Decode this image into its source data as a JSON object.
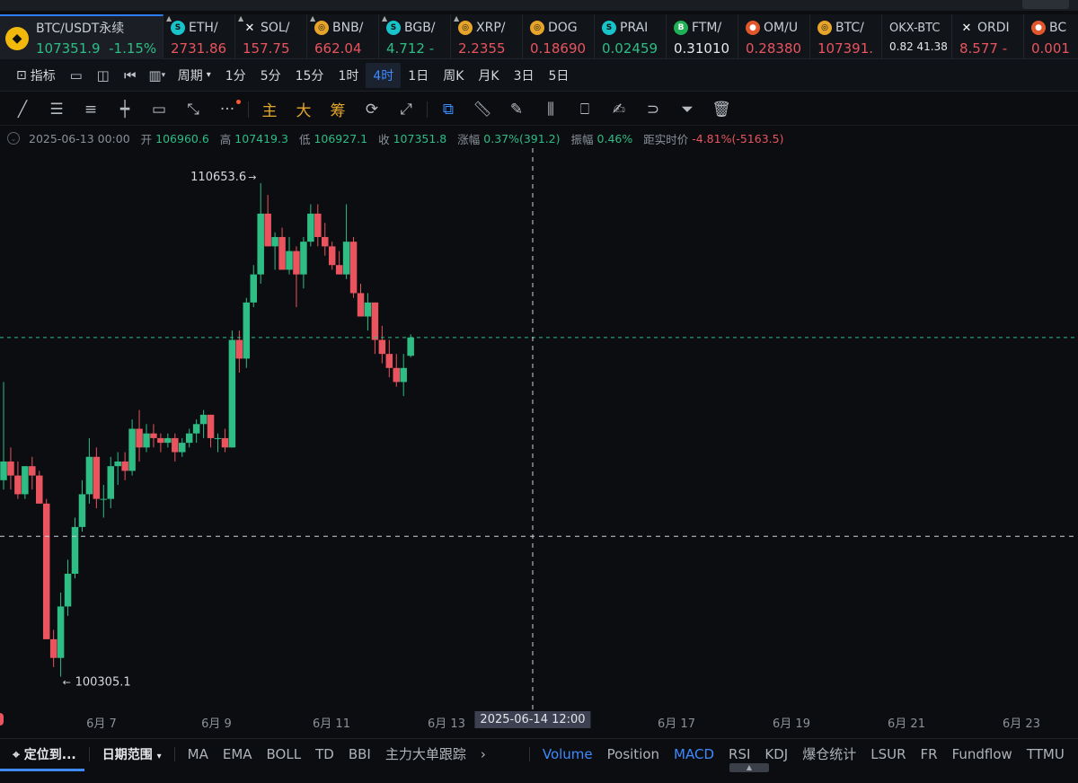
{
  "tickers": [
    {
      "symbol": "BTC/USDT永续",
      "price": "107351.9",
      "change": "-1.15%",
      "coin": "binance",
      "color": "#f0b90b",
      "active": true,
      "price_color": "green",
      "change_color": "green"
    },
    {
      "symbol": "ETH/",
      "price": "2731.86",
      "coin": "s-icon",
      "color": "#18c3c9",
      "price_color": "red"
    },
    {
      "symbol": "SOL/",
      "price": "157.75",
      "coin": "x-icon",
      "color": "#ffffff",
      "price_color": "red"
    },
    {
      "symbol": "BNB/",
      "price": "662.04",
      "coin": "gold",
      "color": "#e6a42b",
      "price_color": "red"
    },
    {
      "symbol": "BGB/",
      "price": "4.712 -",
      "coin": "s-icon",
      "color": "#18c3c9",
      "price_color": "green"
    },
    {
      "symbol": "XRP/",
      "price": "2.2355",
      "coin": "gold",
      "color": "#e6a42b",
      "price_color": "red"
    },
    {
      "symbol": "DOG",
      "price": "0.18690",
      "coin": "gold",
      "color": "#e6a42b",
      "price_color": "red"
    },
    {
      "symbol": "PRAI",
      "price": "0.02459",
      "coin": "s-icon",
      "color": "#18c3c9",
      "price_color": "green"
    },
    {
      "symbol": "FTM/",
      "price": "0.31010",
      "coin": "b-icon",
      "color": "#1fb157",
      "price_color": "white"
    },
    {
      "symbol": "OM/U",
      "price": "0.28380",
      "coin": "o-icon",
      "color": "#e0572b",
      "price_color": "red"
    },
    {
      "symbol": "BTC/",
      "price": "107391.",
      "coin": "gold",
      "color": "#e6a42b",
      "price_color": "red"
    },
    {
      "symbol": "OKX-BTC",
      "price": "0.82  41.38",
      "coin": "",
      "color": "",
      "price_color": "white"
    },
    {
      "symbol": "ORDI",
      "price": "8.577 -",
      "coin": "x-icon",
      "color": "#ffffff",
      "price_color": "red"
    },
    {
      "symbol": "BC",
      "price": "0.001",
      "coin": "o-icon",
      "color": "#e0572b",
      "price_color": "red"
    }
  ],
  "periodbar": {
    "indicators_label": "指标",
    "period_label": "周期",
    "periods": [
      "1分",
      "5分",
      "15分",
      "1时",
      "4时",
      "1日",
      "周K",
      "月K",
      "3日",
      "5日"
    ],
    "selected_period": "4时"
  },
  "drawbar": {
    "main_label": "主",
    "big_label": "大",
    "chip_label": "筹"
  },
  "info": {
    "datetime": "2025-06-13 00:00",
    "open_label": "开",
    "open": "106960.6",
    "high_label": "高",
    "high": "107419.3",
    "low_label": "低",
    "low": "106927.1",
    "close_label": "收",
    "close": "107351.8",
    "change_label": "涨幅",
    "change": "0.37%(391.2)",
    "amp_label": "振幅",
    "amp": "0.46%",
    "dist_label": "距实时价",
    "dist": "-4.81%(-5163.5)"
  },
  "chart_data": {
    "type": "candlestick",
    "interval": "4h",
    "price_range": [
      99400,
      111400
    ],
    "annotations": {
      "high_marker": "110653.6",
      "low_marker": "100305.1"
    },
    "colors": {
      "up": "#2ebd85",
      "down": "#e9545f",
      "crosshair": "#d0d4da",
      "price_line": "#2ebd85"
    },
    "crosshair_price": 107351.9,
    "crosshair_horizontal_price": 103100,
    "candles": [
      {
        "o": 104300,
        "h": 106400,
        "l": 104100,
        "c": 104700
      },
      {
        "o": 104700,
        "h": 105000,
        "l": 104100,
        "c": 104400
      },
      {
        "o": 104400,
        "h": 104700,
        "l": 103900,
        "c": 104000
      },
      {
        "o": 104000,
        "h": 104600,
        "l": 103900,
        "c": 104600
      },
      {
        "o": 104600,
        "h": 104800,
        "l": 104100,
        "c": 104400
      },
      {
        "o": 104400,
        "h": 104500,
        "l": 103800,
        "c": 103800
      },
      {
        "o": 103800,
        "h": 103900,
        "l": 100900,
        "c": 100900
      },
      {
        "o": 100900,
        "h": 101100,
        "l": 100305.1,
        "c": 100500
      },
      {
        "o": 100500,
        "h": 101900,
        "l": 100100,
        "c": 101600
      },
      {
        "o": 101600,
        "h": 102600,
        "l": 101400,
        "c": 102300
      },
      {
        "o": 102300,
        "h": 103500,
        "l": 102200,
        "c": 103300
      },
      {
        "o": 103300,
        "h": 104300,
        "l": 103200,
        "c": 104000
      },
      {
        "o": 104000,
        "h": 105200,
        "l": 103800,
        "c": 104800
      },
      {
        "o": 104800,
        "h": 105000,
        "l": 103700,
        "c": 103900
      },
      {
        "o": 103900,
        "h": 104200,
        "l": 103500,
        "c": 103900
      },
      {
        "o": 103900,
        "h": 104800,
        "l": 103700,
        "c": 104600
      },
      {
        "o": 104600,
        "h": 104900,
        "l": 104200,
        "c": 104700
      },
      {
        "o": 104700,
        "h": 104900,
        "l": 104300,
        "c": 104500
      },
      {
        "o": 104500,
        "h": 105600,
        "l": 104400,
        "c": 105400
      },
      {
        "o": 105400,
        "h": 105800,
        "l": 104700,
        "c": 105000
      },
      {
        "o": 105000,
        "h": 105500,
        "l": 104900,
        "c": 105300
      },
      {
        "o": 105300,
        "h": 105500,
        "l": 105000,
        "c": 105200
      },
      {
        "o": 105200,
        "h": 105300,
        "l": 104900,
        "c": 105100
      },
      {
        "o": 105100,
        "h": 105300,
        "l": 105000,
        "c": 105200
      },
      {
        "o": 105200,
        "h": 105300,
        "l": 104700,
        "c": 104900
      },
      {
        "o": 104900,
        "h": 105200,
        "l": 104800,
        "c": 105100
      },
      {
        "o": 105100,
        "h": 105400,
        "l": 105000,
        "c": 105300
      },
      {
        "o": 105300,
        "h": 105600,
        "l": 105100,
        "c": 105500
      },
      {
        "o": 105500,
        "h": 105800,
        "l": 105200,
        "c": 105700
      },
      {
        "o": 105700,
        "h": 105700,
        "l": 105000,
        "c": 105200
      },
      {
        "o": 105200,
        "h": 105300,
        "l": 104900,
        "c": 105200
      },
      {
        "o": 105200,
        "h": 105400,
        "l": 104900,
        "c": 105000
      },
      {
        "o": 105000,
        "h": 107500,
        "l": 105000,
        "c": 107300
      },
      {
        "o": 107300,
        "h": 107500,
        "l": 106600,
        "c": 106900
      },
      {
        "o": 106900,
        "h": 108200,
        "l": 106700,
        "c": 108100
      },
      {
        "o": 108100,
        "h": 108900,
        "l": 108000,
        "c": 108700
      },
      {
        "o": 108700,
        "h": 110653.6,
        "l": 108500,
        "c": 110000
      },
      {
        "o": 110000,
        "h": 110400,
        "l": 109300,
        "c": 109300
      },
      {
        "o": 109300,
        "h": 109600,
        "l": 108800,
        "c": 109500
      },
      {
        "o": 109500,
        "h": 109700,
        "l": 108800,
        "c": 108800
      },
      {
        "o": 108800,
        "h": 109500,
        "l": 108700,
        "c": 109200
      },
      {
        "o": 109200,
        "h": 109300,
        "l": 108000,
        "c": 108700
      },
      {
        "o": 108700,
        "h": 109500,
        "l": 108400,
        "c": 109400
      },
      {
        "o": 109400,
        "h": 110200,
        "l": 109300,
        "c": 110000
      },
      {
        "o": 110000,
        "h": 110200,
        "l": 109300,
        "c": 109500
      },
      {
        "o": 109500,
        "h": 109800,
        "l": 109100,
        "c": 109300
      },
      {
        "o": 109300,
        "h": 109400,
        "l": 108800,
        "c": 108900
      },
      {
        "o": 108900,
        "h": 109200,
        "l": 108700,
        "c": 108700
      },
      {
        "o": 108700,
        "h": 110200,
        "l": 108600,
        "c": 109400
      },
      {
        "o": 109400,
        "h": 109500,
        "l": 108200,
        "c": 108300
      },
      {
        "o": 108300,
        "h": 108500,
        "l": 107800,
        "c": 107800
      },
      {
        "o": 107800,
        "h": 108300,
        "l": 107500,
        "c": 108100
      },
      {
        "o": 108100,
        "h": 108100,
        "l": 107000,
        "c": 107300
      },
      {
        "o": 107300,
        "h": 107600,
        "l": 106800,
        "c": 107000
      },
      {
        "o": 107000,
        "h": 107300,
        "l": 106500,
        "c": 106700
      },
      {
        "o": 106700,
        "h": 107000,
        "l": 106300,
        "c": 106400
      },
      {
        "o": 106400,
        "h": 107000,
        "l": 106100,
        "c": 106700
      },
      {
        "o": 106960.6,
        "h": 107419.3,
        "l": 106927.1,
        "c": 107351.8
      }
    ]
  },
  "timeaxis": {
    "labels": [
      "6月 7",
      "6月 9",
      "6月 11",
      "6月 13",
      "6月 17",
      "6月 19",
      "6月 21",
      "6月 23"
    ],
    "cursor_label": "2025-06-14 12:00"
  },
  "indbar": {
    "locate_label": "定位到...",
    "range_label": "日期范围",
    "main_indicators": [
      "MA",
      "EMA",
      "BOLL",
      "TD",
      "BBI",
      "主力大单跟踪"
    ],
    "sub_indicators": [
      "Volume",
      "Position",
      "MACD",
      "RSI",
      "KDJ",
      "爆仓统计",
      "LSUR",
      "FR",
      "Fundflow",
      "TTMU"
    ],
    "active_sub": [
      "Volume",
      "MACD"
    ]
  }
}
